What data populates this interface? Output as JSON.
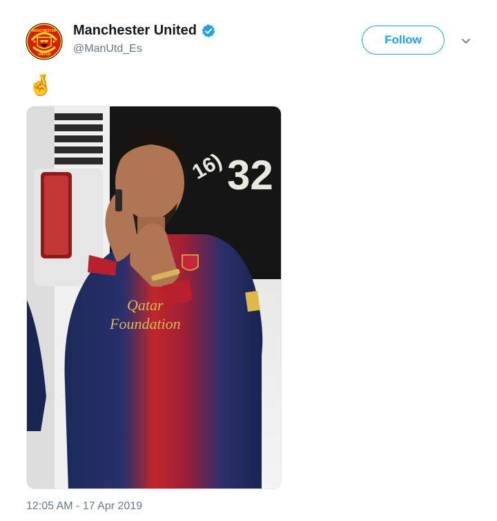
{
  "account": {
    "display_name": "Manchester United",
    "handle": "@ManUtd_Es",
    "verified": true,
    "avatar_icon": "manchester-united-crest",
    "crest_text_top": "MANCHESTER",
    "crest_text_bottom": "UNITED"
  },
  "actions": {
    "follow_label": "Follow",
    "more_icon": "chevron-down-icon"
  },
  "tweet": {
    "text": "🤞",
    "timestamp": "12:05 AM - 17 Apr 2019"
  },
  "media": {
    "jersey_sponsor_line1": "Qatar",
    "jersey_sponsor_line2": "Foundation",
    "vehicle_number": "32",
    "vehicle_partial_text": "16)"
  },
  "colors": {
    "accent": "#1da1f2",
    "secondary_text": "#657786",
    "primary_text": "#14171a",
    "crest_red": "#d81e05",
    "crest_gold": "#fbe122"
  }
}
